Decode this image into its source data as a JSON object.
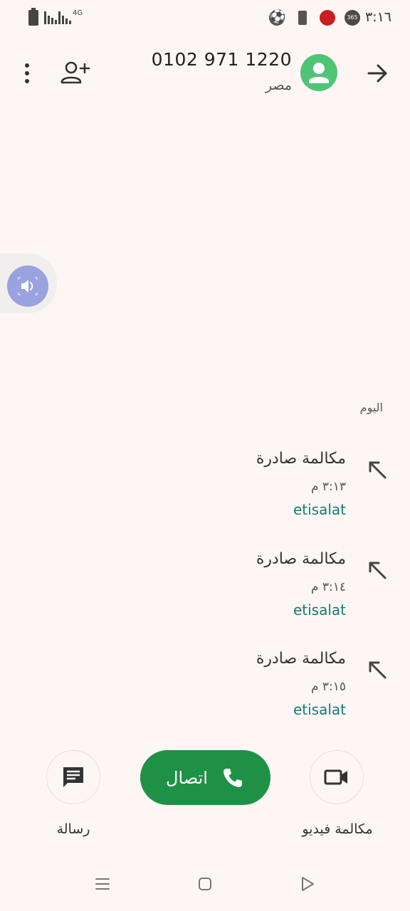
{
  "status_bar": {
    "time": "٣:١٦",
    "network": "4G"
  },
  "header": {
    "phone_number": "0102 971 1220",
    "country": "مصر"
  },
  "history": {
    "section_label": "اليوم",
    "calls": [
      {
        "type": "مكالمة صادرة",
        "time": "٣:١٣ م",
        "carrier": "etisalat"
      },
      {
        "type": "مكالمة صادرة",
        "time": "٣:١٤ م",
        "carrier": "etisalat"
      },
      {
        "type": "مكالمة صادرة",
        "time": "٣:١٥ م",
        "carrier": "etisalat"
      }
    ]
  },
  "actions": {
    "call_label": "اتصال",
    "message_label": "رسالة",
    "video_label": "مكالمة فيديو"
  },
  "icons": {
    "back": "arrow-forward-icon",
    "avatar": "person-icon",
    "menu": "more-vert-icon",
    "add_contact": "person-add-icon",
    "speaker": "speaker-icon",
    "outgoing": "outgoing-call-icon",
    "message": "message-icon",
    "phone": "phone-icon",
    "video": "videocam-icon"
  },
  "colors": {
    "background": "#fdf6f4",
    "avatar": "#4fc475",
    "call_button": "#1f9147",
    "carrier_text": "#167a78",
    "speaker_button": "#9aa2df"
  }
}
